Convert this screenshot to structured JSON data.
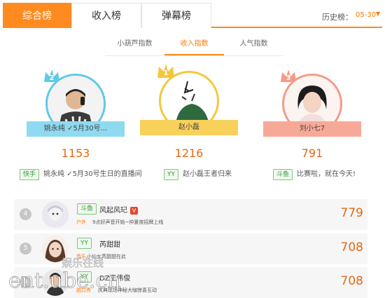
{
  "tabs": {
    "items": [
      {
        "label": "综合榜",
        "active": true
      },
      {
        "label": "收入榜",
        "active": false
      },
      {
        "label": "弹幕榜",
        "active": false
      }
    ],
    "history_label": "历史榜：",
    "history_date": "05-30"
  },
  "subtabs": {
    "items": [
      {
        "label": "小葫芦指数",
        "active": false
      },
      {
        "label": "收入指数",
        "active": true
      },
      {
        "label": "人气指数",
        "active": false
      }
    ]
  },
  "podium": [
    {
      "rank": "2",
      "name": "姚永纯 ✓5月30号...",
      "score": "1153",
      "ring_color": "#5fc9e6",
      "crown_color": "#5fc9e6"
    },
    {
      "rank": "1",
      "name": "赵小磊",
      "score": "1216",
      "ring_color": "#f6c63a",
      "crown_color": "#f6c63a"
    },
    {
      "rank": "3",
      "name": "刘小七7",
      "score": "791",
      "ring_color": "#f49a86",
      "crown_color": "#f49a86"
    }
  ],
  "descriptions": [
    {
      "platform": "快手",
      "text": "姚永纯 ✓5月30号生日的直播间"
    },
    {
      "platform": "YY",
      "text": "赵小磊王者归来"
    },
    {
      "platform": "斗鱼",
      "text": "比赛啦，就在今天!"
    }
  ],
  "list": [
    {
      "rank": "4",
      "platform": "斗鱼",
      "name": "风起风玘",
      "badge": "V",
      "category": "户外",
      "desc": "9点好声音开始~仲夏夜招牌上线",
      "score": "779"
    },
    {
      "rank": "5",
      "platform": "YY",
      "name": "芮甜甜",
      "badge": "",
      "category": "音乐",
      "desc": "小仙女芮甜甜在此",
      "score": "708"
    },
    {
      "rank": "6",
      "platform": "YY",
      "name": "DZ王伟俊",
      "badge": "",
      "category": "脱口秀",
      "desc": "庆典现场神秘大咖惊喜互动",
      "score": "708"
    }
  ],
  "watermark": {
    "cn": "娱乐在线",
    "en": "ent.ube.cn"
  },
  "colors": {
    "accent": "#ff8a1f",
    "score": "#e36a16",
    "platform_green": "#3a9a3a"
  }
}
